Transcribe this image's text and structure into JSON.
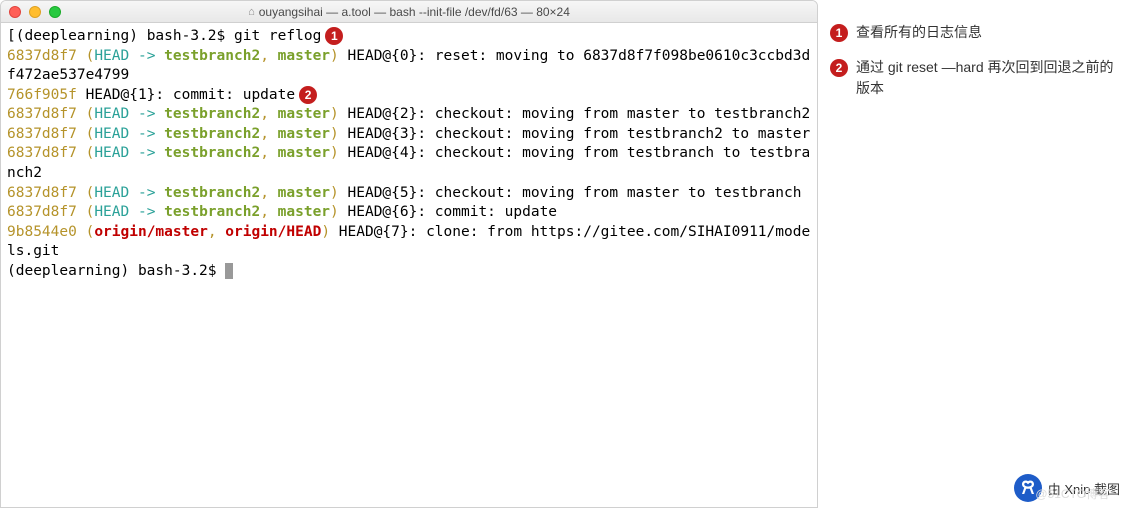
{
  "window": {
    "title": "ouyangsihai — a.tool — bash --init-file /dev/fd/63 — 80×24"
  },
  "prompt": {
    "env": "(deeplearning)",
    "shell": "bash-3.2$",
    "command1": "git reflog"
  },
  "reflog": [
    {
      "hash": "6837d8f7",
      "refs_head": "HEAD -> ",
      "refs_branch": "testbranch2",
      "refs_sep": ", ",
      "refs_extra": "master",
      "rest": " HEAD@{0}: reset: moving to 6837d8f7f098be0610c3ccbd3df472ae537e4799"
    },
    {
      "hash": "766f905f",
      "no_refs": true,
      "rest": " HEAD@{1}: commit: update"
    },
    {
      "hash": "6837d8f7",
      "refs_head": "HEAD -> ",
      "refs_branch": "testbranch2",
      "refs_sep": ", ",
      "refs_extra": "master",
      "rest": " HEAD@{2}: checkout: moving from master to testbranch2"
    },
    {
      "hash": "6837d8f7",
      "refs_head": "HEAD -> ",
      "refs_branch": "testbranch2",
      "refs_sep": ", ",
      "refs_extra": "master",
      "rest": " HEAD@{3}: checkout: moving from testbranch2 to master"
    },
    {
      "hash": "6837d8f7",
      "refs_head": "HEAD -> ",
      "refs_branch": "testbranch2",
      "refs_sep": ", ",
      "refs_extra": "master",
      "rest": " HEAD@{4}: checkout: moving from testbranch to testbranch2"
    },
    {
      "hash": "6837d8f7",
      "refs_head": "HEAD -> ",
      "refs_branch": "testbranch2",
      "refs_sep": ", ",
      "refs_extra": "master",
      "rest": " HEAD@{5}: checkout: moving from master to testbranch"
    },
    {
      "hash": "6837d8f7",
      "refs_head": "HEAD -> ",
      "refs_branch": "testbranch2",
      "refs_sep": ", ",
      "refs_extra": "master",
      "rest": " HEAD@{6}: commit: update"
    },
    {
      "hash": "9b8544e0",
      "origin": true,
      "refs_origin1": "origin/master",
      "refs_sep": ", ",
      "refs_origin2": "origin/HEAD",
      "rest": " HEAD@{7}: clone: from https://gitee.com/SIHAI0911/models.git"
    }
  ],
  "badges": {
    "b1": "1",
    "b2": "2"
  },
  "annotations": [
    {
      "num": "1",
      "text": "查看所有的日志信息"
    },
    {
      "num": "2",
      "text": "通过 git reset —hard 再次回到回退之前的版本"
    }
  ],
  "watermark": {
    "text": "由 Xnip 截图",
    "blog": "@51CTO博客"
  }
}
